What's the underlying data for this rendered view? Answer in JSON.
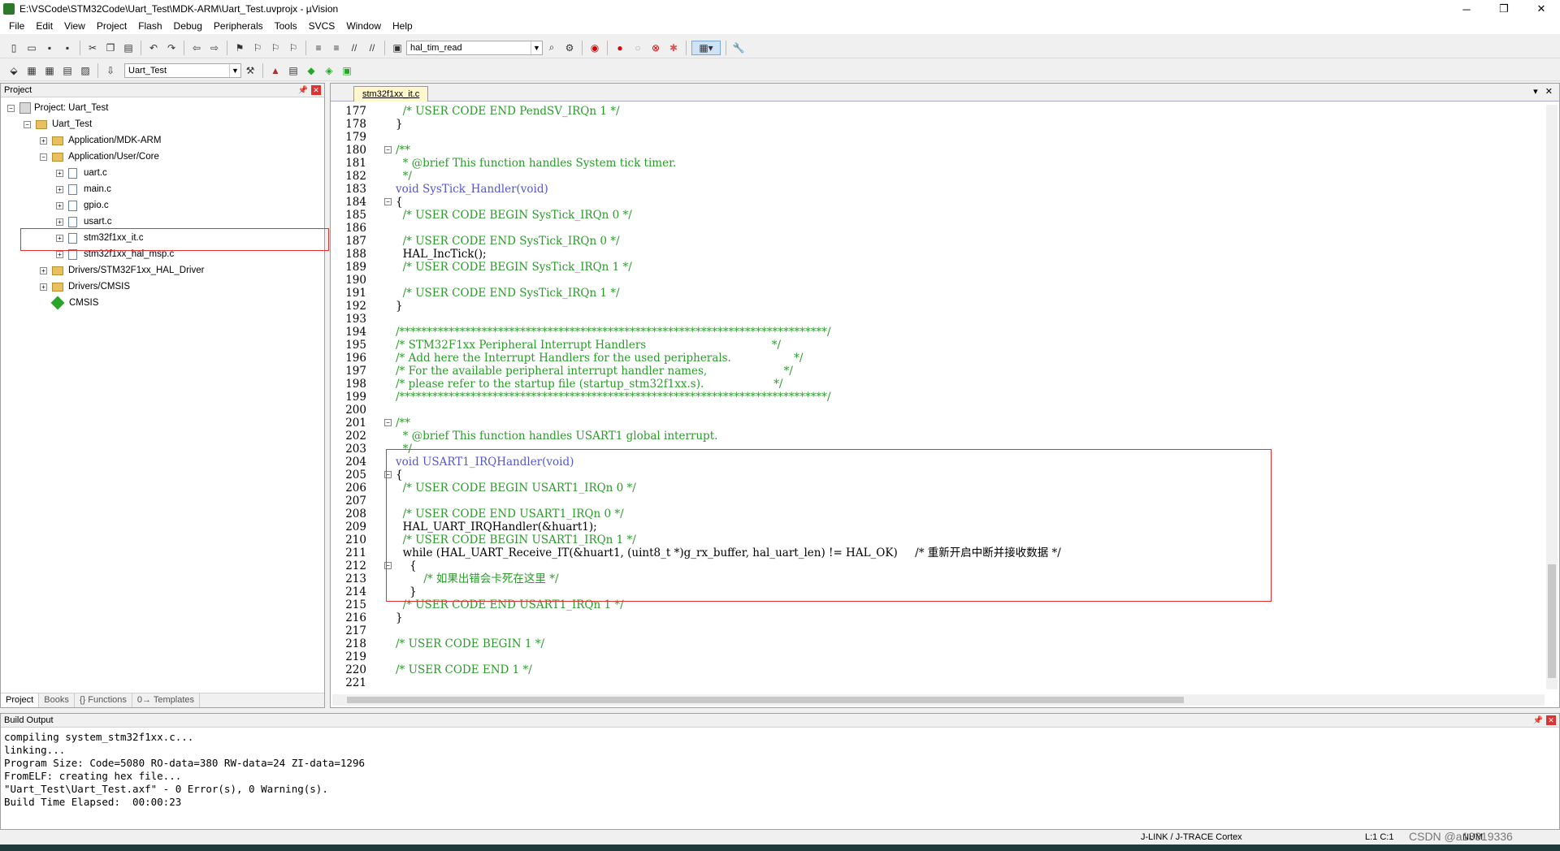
{
  "window": {
    "title": "E:\\VSCode\\STM32Code\\Uart_Test\\MDK-ARM\\Uart_Test.uvprojx - µVision",
    "minimize": "─",
    "restore": "❐",
    "close": "✕"
  },
  "menu": [
    "File",
    "Edit",
    "View",
    "Project",
    "Flash",
    "Debug",
    "Peripherals",
    "Tools",
    "SVCS",
    "Window",
    "Help"
  ],
  "toolbar": {
    "find_combo": "hal_tim_read",
    "target_combo": "Uart_Test"
  },
  "project": {
    "header": "Project",
    "tree": [
      {
        "label": "Project: Uart_Test"
      },
      {
        "label": "Uart_Test"
      },
      {
        "label": "Application/MDK-ARM"
      },
      {
        "label": "Application/User/Core"
      },
      {
        "label": "uart.c"
      },
      {
        "label": "main.c"
      },
      {
        "label": "gpio.c"
      },
      {
        "label": "usart.c"
      },
      {
        "label": "stm32f1xx_it.c"
      },
      {
        "label": "stm32f1xx_hal_msp.c"
      },
      {
        "label": "Drivers/STM32F1xx_HAL_Driver"
      },
      {
        "label": "Drivers/CMSIS"
      },
      {
        "label": "CMSIS"
      }
    ],
    "tabs": [
      "Project",
      "Books",
      "{} Functions",
      "0→ Templates"
    ]
  },
  "editor": {
    "tab": "stm32f1xx_it.c",
    "lines": [
      {
        "n": "177",
        "t": "  /* USER CODE END PendSV_IRQn 1 */",
        "c": "cm"
      },
      {
        "n": "178",
        "t": "}",
        "c": ""
      },
      {
        "n": "179",
        "t": "",
        "c": ""
      },
      {
        "n": "180",
        "t": "/**",
        "c": "cm"
      },
      {
        "n": "181",
        "t": "  * @brief This function handles System tick timer.",
        "c": "cm"
      },
      {
        "n": "182",
        "t": "  */",
        "c": "cm"
      },
      {
        "n": "183",
        "t": "void SysTick_Handler(void)",
        "c": "kw"
      },
      {
        "n": "184",
        "t": "{",
        "c": ""
      },
      {
        "n": "185",
        "t": "  /* USER CODE BEGIN SysTick_IRQn 0 */",
        "c": "cm"
      },
      {
        "n": "186",
        "t": "",
        "c": ""
      },
      {
        "n": "187",
        "t": "  /* USER CODE END SysTick_IRQn 0 */",
        "c": "cm"
      },
      {
        "n": "188",
        "t": "  HAL_IncTick();",
        "c": ""
      },
      {
        "n": "189",
        "t": "  /* USER CODE BEGIN SysTick_IRQn 1 */",
        "c": "cm"
      },
      {
        "n": "190",
        "t": "",
        "c": ""
      },
      {
        "n": "191",
        "t": "  /* USER CODE END SysTick_IRQn 1 */",
        "c": "cm"
      },
      {
        "n": "192",
        "t": "}",
        "c": ""
      },
      {
        "n": "193",
        "t": "",
        "c": ""
      },
      {
        "n": "194",
        "t": "/******************************************************************************/",
        "c": "cm"
      },
      {
        "n": "195",
        "t": "/* STM32F1xx Peripheral Interrupt Handlers                                    */",
        "c": "cm"
      },
      {
        "n": "196",
        "t": "/* Add here the Interrupt Handlers for the used peripherals.                  */",
        "c": "cm"
      },
      {
        "n": "197",
        "t": "/* For the available peripheral interrupt handler names,                      */",
        "c": "cm"
      },
      {
        "n": "198",
        "t": "/* please refer to the startup file (startup_stm32f1xx.s).                    */",
        "c": "cm"
      },
      {
        "n": "199",
        "t": "/******************************************************************************/",
        "c": "cm"
      },
      {
        "n": "200",
        "t": "",
        "c": ""
      },
      {
        "n": "201",
        "t": "/**",
        "c": "cm"
      },
      {
        "n": "202",
        "t": "  * @brief This function handles USART1 global interrupt.",
        "c": "cm"
      },
      {
        "n": "203",
        "t": "  */",
        "c": "cm"
      },
      {
        "n": "204",
        "t": "void USART1_IRQHandler(void)",
        "c": "kw"
      },
      {
        "n": "205",
        "t": "{",
        "c": ""
      },
      {
        "n": "206",
        "t": "  /* USER CODE BEGIN USART1_IRQn 0 */",
        "c": "cm"
      },
      {
        "n": "207",
        "t": "",
        "c": ""
      },
      {
        "n": "208",
        "t": "  /* USER CODE END USART1_IRQn 0 */",
        "c": "cm"
      },
      {
        "n": "209",
        "t": "  HAL_UART_IRQHandler(&huart1);",
        "c": ""
      },
      {
        "n": "210",
        "t": "  /* USER CODE BEGIN USART1_IRQn 1 */",
        "c": "cm"
      },
      {
        "n": "211",
        "t": "  while (HAL_UART_Receive_IT(&huart1, (uint8_t *)g_rx_buffer, hal_uart_len) != HAL_OK)     /* 重新开启中断并接收数据 */",
        "c": ""
      },
      {
        "n": "212",
        "t": "    {",
        "c": ""
      },
      {
        "n": "213",
        "t": "        /* 如果出错会卡死在这里 */",
        "c": "cm"
      },
      {
        "n": "214",
        "t": "    }",
        "c": ""
      },
      {
        "n": "215",
        "t": "  /* USER CODE END USART1_IRQn 1 */",
        "c": "cm"
      },
      {
        "n": "216",
        "t": "}",
        "c": ""
      },
      {
        "n": "217",
        "t": "",
        "c": ""
      },
      {
        "n": "218",
        "t": "/* USER CODE BEGIN 1 */",
        "c": "cm"
      },
      {
        "n": "219",
        "t": "",
        "c": ""
      },
      {
        "n": "220",
        "t": "/* USER CODE END 1 */",
        "c": "cm"
      },
      {
        "n": "221",
        "t": "",
        "c": ""
      }
    ]
  },
  "build": {
    "header": "Build Output",
    "lines": [
      "compiling system_stm32f1xx.c...",
      "linking...",
      "Program Size: Code=5080 RO-data=380 RW-data=24 ZI-data=1296",
      "FromELF: creating hex file...",
      "\"Uart_Test\\Uart_Test.axf\" - 0 Error(s), 0 Warning(s).",
      "Build Time Elapsed:  00:00:23"
    ]
  },
  "status": {
    "debugger": "J-LINK / J-TRACE Cortex",
    "position": "L:1 C:1",
    "num": "NUM",
    "watermark": "CSDN @a13319336"
  },
  "colors": {
    "comment": "#2a9a2a",
    "keyword": "#5555cc",
    "highlight_box": "#e03030"
  }
}
